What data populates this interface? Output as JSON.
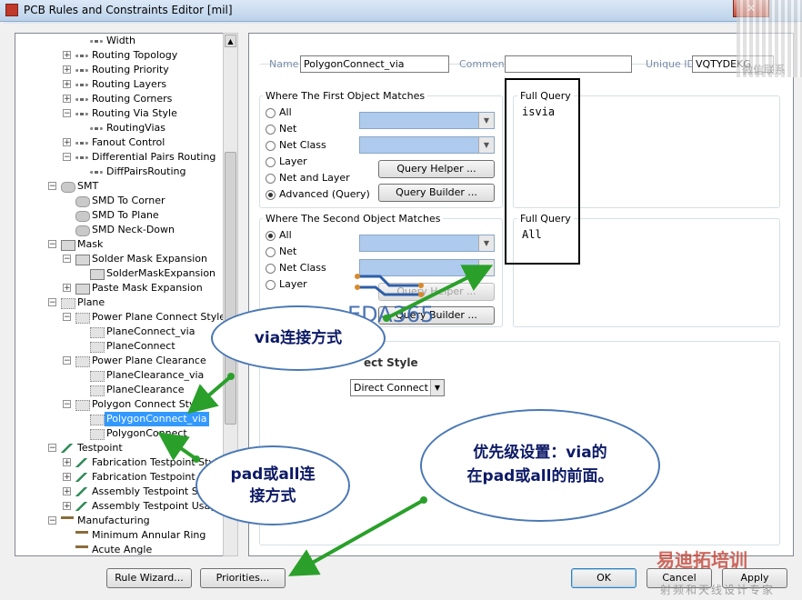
{
  "window": {
    "title": "PCB Rules and Constraints Editor [mil]",
    "close_glyph": "✕"
  },
  "tree": {
    "rows": [
      {
        "label": "Width",
        "indent": 4,
        "expander": "",
        "icon": "route-icon"
      },
      {
        "label": "Routing Topology",
        "indent": 3,
        "expander": "+",
        "icon": "route-icon"
      },
      {
        "label": "Routing Priority",
        "indent": 3,
        "expander": "+",
        "icon": "route-icon"
      },
      {
        "label": "Routing Layers",
        "indent": 3,
        "expander": "+",
        "icon": "route-icon"
      },
      {
        "label": "Routing Corners",
        "indent": 3,
        "expander": "+",
        "icon": "route-icon"
      },
      {
        "label": "Routing Via Style",
        "indent": 3,
        "expander": "−",
        "icon": "route-icon"
      },
      {
        "label": "RoutingVias",
        "indent": 4,
        "expander": "",
        "icon": "route-icon"
      },
      {
        "label": "Fanout Control",
        "indent": 3,
        "expander": "+",
        "icon": "route-icon"
      },
      {
        "label": "Differential Pairs Routing",
        "indent": 3,
        "expander": "−",
        "icon": "route-icon"
      },
      {
        "label": "DiffPairsRouting",
        "indent": 4,
        "expander": "",
        "icon": "route-icon"
      },
      {
        "label": "SMT",
        "indent": 1,
        "expander": "−",
        "icon": "smt-icon"
      },
      {
        "label": "SMD To Corner",
        "indent": 3,
        "expander": "",
        "icon": "smt-icon"
      },
      {
        "label": "SMD To Plane",
        "indent": 3,
        "expander": "",
        "icon": "smt-icon"
      },
      {
        "label": "SMD Neck-Down",
        "indent": 3,
        "expander": "",
        "icon": "smt-icon"
      },
      {
        "label": "Mask",
        "indent": 1,
        "expander": "−",
        "icon": "mask-icon"
      },
      {
        "label": "Solder Mask Expansion",
        "indent": 3,
        "expander": "−",
        "icon": "mask-icon"
      },
      {
        "label": "SolderMaskExpansion",
        "indent": 4,
        "expander": "",
        "icon": "mask-icon"
      },
      {
        "label": "Paste Mask Expansion",
        "indent": 3,
        "expander": "+",
        "icon": "mask-icon"
      },
      {
        "label": "Plane",
        "indent": 1,
        "expander": "−",
        "icon": "plane-icon"
      },
      {
        "label": "Power Plane Connect Style",
        "indent": 3,
        "expander": "−",
        "icon": "plane-icon"
      },
      {
        "label": "PlaneConnect_via",
        "indent": 4,
        "expander": "",
        "icon": "plane-icon"
      },
      {
        "label": "PlaneConnect",
        "indent": 4,
        "expander": "",
        "icon": "plane-icon"
      },
      {
        "label": "Power Plane Clearance",
        "indent": 3,
        "expander": "−",
        "icon": "plane-icon"
      },
      {
        "label": "PlaneClearance_via",
        "indent": 4,
        "expander": "",
        "icon": "plane-icon"
      },
      {
        "label": "PlaneClearance",
        "indent": 4,
        "expander": "",
        "icon": "plane-icon"
      },
      {
        "label": "Polygon Connect Style",
        "indent": 3,
        "expander": "−",
        "icon": "plane-icon"
      },
      {
        "label": "PolygonConnect_via",
        "indent": 4,
        "expander": "",
        "icon": "plane-icon",
        "selected": true
      },
      {
        "label": "PolygonConnect",
        "indent": 4,
        "expander": "",
        "icon": "plane-icon"
      },
      {
        "label": "Testpoint",
        "indent": 1,
        "expander": "−",
        "icon": "testpoint-icon"
      },
      {
        "label": "Fabrication Testpoint Style",
        "indent": 3,
        "expander": "+",
        "icon": "testpoint-icon"
      },
      {
        "label": "Fabrication Testpoint Usage",
        "indent": 3,
        "expander": "+",
        "icon": "testpoint-icon"
      },
      {
        "label": "Assembly Testpoint Style",
        "indent": 3,
        "expander": "+",
        "icon": "testpoint-icon"
      },
      {
        "label": "Assembly Testpoint Usage",
        "indent": 3,
        "expander": "+",
        "icon": "testpoint-icon"
      },
      {
        "label": "Manufacturing",
        "indent": 1,
        "expander": "−",
        "icon": "manufacturing-icon"
      },
      {
        "label": "Minimum Annular Ring",
        "indent": 3,
        "expander": "",
        "icon": "manufacturing-icon"
      },
      {
        "label": "Acute Angle",
        "indent": 3,
        "expander": "",
        "icon": "manufacturing-icon"
      }
    ]
  },
  "rule": {
    "name_label": "Name",
    "name_value": "PolygonConnect_via",
    "comment_label": "Comment",
    "comment_value": "",
    "uid_label": "Unique ID",
    "uid_value": "VQTYDEKG"
  },
  "first_match": {
    "title": "Where The First Object Matches",
    "options": [
      "All",
      "Net",
      "Net Class",
      "Layer",
      "Net and Layer",
      "Advanced (Query)"
    ],
    "selected": "Advanced (Query)",
    "query_helper": "Query Helper ...",
    "query_builder": "Query Builder ...",
    "full_query_label": "Full Query",
    "full_query": "isvia"
  },
  "second_match": {
    "title": "Where The Second Object Matches",
    "options": [
      "All",
      "Net",
      "Net Class",
      "Layer"
    ],
    "selected": "All",
    "query_helper": "Query Helper ...",
    "query_builder": "Query Builder ...",
    "full_query_label": "Full Query",
    "full_query": "All"
  },
  "constraints": {
    "connect_style_title": "ect Style",
    "connect_style_value": "Direct Connect"
  },
  "buttons": {
    "rule_wizard": "Rule Wizard...",
    "priorities": "Priorities...",
    "ok": "OK",
    "cancel": "Cancel",
    "apply": "Apply"
  },
  "annotations": {
    "via_connect": "via连接方式",
    "pad_all_line1": "pad或all连",
    "pad_all_line2": "接方式",
    "priority_line1": "优先级设置：via的",
    "priority_line2": "在pad或all的前面。",
    "watermark_eda": "EDA365",
    "watermark_cn1": "易迪拓培训",
    "watermark_cn2": "射频和天线设计专家",
    "watermark_wechat": "微信联系"
  },
  "colors": {
    "selection": "#3399ff",
    "combo_fill": "#aecbee",
    "arrow_green": "#2aa02a",
    "cloud_border": "#4a78b5"
  }
}
